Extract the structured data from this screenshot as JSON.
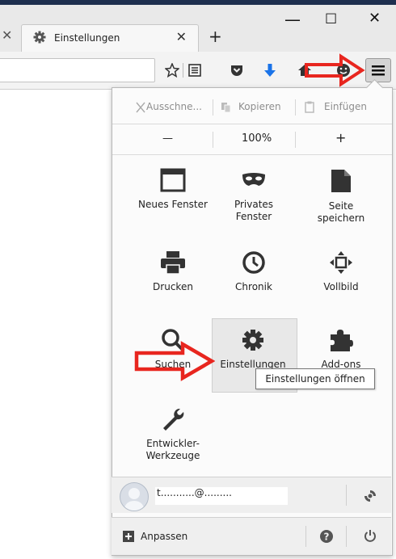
{
  "browser": {
    "tab": {
      "title": "Einstellungen"
    },
    "window_controls": {
      "minimize": "—",
      "maximize": "☐",
      "close": "✕"
    },
    "new_tab": "+",
    "prev_tab_close": "✕"
  },
  "menu": {
    "edit": {
      "cut": "Ausschne...",
      "copy": "Kopieren",
      "paste": "Einfügen"
    },
    "zoom": {
      "minus": "—",
      "value": "100%",
      "plus": "+"
    },
    "items": [
      {
        "label": "Neues Fenster",
        "icon": "window-icon"
      },
      {
        "label": "Privates\nFenster",
        "icon": "mask-icon"
      },
      {
        "label": "Seite\nspeichern",
        "icon": "page-icon"
      },
      {
        "label": "Drucken",
        "icon": "printer-icon"
      },
      {
        "label": "Chronik",
        "icon": "clock-icon"
      },
      {
        "label": "Vollbild",
        "icon": "fullscreen-icon"
      },
      {
        "label": "Suchen",
        "icon": "search-icon"
      },
      {
        "label": "Einstellungen",
        "icon": "gear-icon"
      },
      {
        "label": "Add-ons",
        "icon": "puzzle-icon"
      },
      {
        "label": "Entwickler-\nWerkzeuge",
        "icon": "wrench-icon"
      }
    ],
    "tooltip": "Einstellungen öffnen",
    "account": {
      "label": "t...........@........."
    },
    "customize": "Anpassen"
  },
  "colors": {
    "arrow": "#e8261f",
    "highlight": "#e8e8e8",
    "download": "#1a73e8"
  }
}
